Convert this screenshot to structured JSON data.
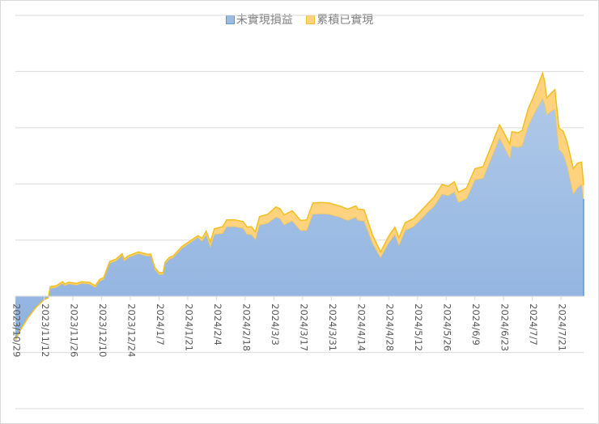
{
  "chart_data": {
    "type": "area",
    "stacked": true,
    "title": "",
    "xlabel": "",
    "ylabel": "",
    "start_date": "2023/10/29",
    "x_unit": "days since 2023/10/29",
    "ylim": [
      -2,
      5
    ],
    "xlim": [
      0,
      277
    ],
    "grid": true,
    "legend_position": "top",
    "x_tick_labels": [
      "2023/10/29",
      "2023/11/12",
      "2023/11/26",
      "2023/12/10",
      "2023/12/24",
      "2024/1/7",
      "2024/1/21",
      "2024/2/4",
      "2024/2/18",
      "2024/3/3",
      "2024/3/17",
      "2024/3/31",
      "2024/4/14",
      "2024/4/28",
      "2024/5/12",
      "2024/5/26",
      "2024/6/9",
      "2024/6/23",
      "2024/7/7",
      "2024/7/21"
    ],
    "x": [
      0,
      2,
      6,
      10,
      14,
      16,
      17,
      20,
      23,
      24,
      26,
      30,
      32,
      36,
      39,
      41,
      43,
      46,
      49,
      52,
      53,
      55,
      60,
      64,
      66,
      68,
      70,
      72,
      73,
      75,
      77,
      81,
      85,
      89,
      91,
      93,
      95,
      97,
      101,
      103,
      107,
      111,
      113,
      115,
      117,
      119,
      123,
      127,
      129,
      131,
      135,
      139,
      142,
      145,
      149,
      153,
      158,
      162,
      166,
      167,
      170,
      174,
      178,
      182,
      185,
      187,
      190,
      194,
      198,
      201,
      204,
      208,
      211,
      214,
      216,
      220,
      224,
      228,
      232,
      236,
      238,
      241,
      242,
      245,
      247,
      250,
      253,
      257,
      258,
      259,
      261,
      263,
      265,
      267,
      269,
      272,
      274,
      276,
      277
    ],
    "series": [
      {
        "name": "未實現損益",
        "color": "#9bbbe3",
        "values": [
          -0.78,
          -0.63,
          -0.39,
          -0.2,
          -0.06,
          -0.03,
          0.14,
          0.16,
          0.23,
          0.19,
          0.22,
          0.2,
          0.23,
          0.22,
          0.16,
          0.27,
          0.3,
          0.59,
          0.63,
          0.73,
          0.63,
          0.69,
          0.76,
          0.72,
          0.72,
          0.48,
          0.39,
          0.39,
          0.58,
          0.66,
          0.69,
          0.85,
          0.95,
          1.05,
          0.98,
          1.1,
          0.88,
          1.1,
          1.12,
          1.24,
          1.24,
          1.21,
          1.1,
          1.1,
          1.01,
          1.27,
          1.3,
          1.41,
          1.38,
          1.27,
          1.34,
          1.17,
          1.17,
          1.46,
          1.47,
          1.46,
          1.41,
          1.35,
          1.41,
          1.35,
          1.34,
          0.95,
          0.69,
          0.95,
          1.1,
          0.91,
          1.17,
          1.24,
          1.38,
          1.5,
          1.6,
          1.82,
          1.79,
          1.86,
          1.67,
          1.74,
          2.07,
          2.1,
          2.46,
          2.82,
          2.68,
          2.46,
          2.68,
          2.65,
          2.68,
          3.04,
          3.26,
          3.52,
          3.43,
          3.23,
          3.29,
          3.33,
          2.61,
          2.54,
          2.32,
          1.82,
          1.93,
          1.99,
          1.73
        ]
      },
      {
        "name": "累積已實現",
        "color": "#ffd27f",
        "values": [
          0,
          0,
          0,
          0,
          0,
          0,
          0.03,
          0.03,
          0.03,
          0.03,
          0.03,
          0.03,
          0.03,
          0.03,
          0.03,
          0.03,
          0.03,
          0.03,
          0.03,
          0.03,
          0.03,
          0.03,
          0.03,
          0.03,
          0.03,
          0.03,
          0.03,
          0.03,
          0.03,
          0.03,
          0.03,
          0.03,
          0.03,
          0.03,
          0.05,
          0.06,
          0.08,
          0.1,
          0.12,
          0.12,
          0.12,
          0.12,
          0.13,
          0.14,
          0.14,
          0.15,
          0.16,
          0.18,
          0.18,
          0.18,
          0.18,
          0.18,
          0.19,
          0.2,
          0.2,
          0.2,
          0.2,
          0.2,
          0.2,
          0.2,
          0.2,
          0.15,
          0.1,
          0.12,
          0.13,
          0.13,
          0.14,
          0.14,
          0.15,
          0.15,
          0.16,
          0.17,
          0.17,
          0.18,
          0.18,
          0.19,
          0.2,
          0.21,
          0.22,
          0.23,
          0.24,
          0.25,
          0.25,
          0.26,
          0.27,
          0.3,
          0.33,
          0.45,
          0.4,
          0.3,
          0.32,
          0.35,
          0.38,
          0.4,
          0.42,
          0.45,
          0.44,
          0.4,
          0.25
        ]
      }
    ]
  }
}
